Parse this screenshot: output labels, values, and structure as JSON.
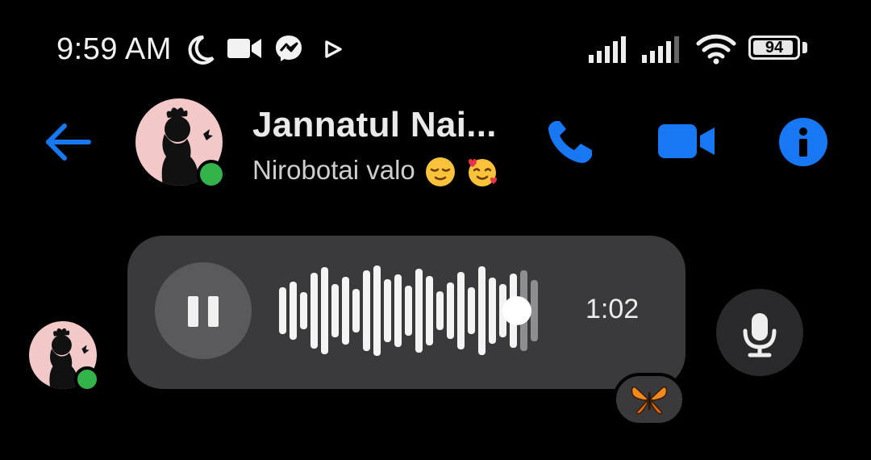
{
  "status_bar": {
    "time": "9:59 AM",
    "battery_level": 94,
    "battery_label": "94",
    "icons": [
      "moon-icon",
      "video-camera-icon",
      "messenger-icon",
      "play-icon",
      "signal-icon",
      "signal-icon",
      "wifi-icon",
      "battery-icon"
    ]
  },
  "header": {
    "back_icon": "back-arrow-icon",
    "contact_name": "Jannatul Nai...",
    "contact_status": "Nirobotai valo",
    "status_emojis": [
      "relieved-face",
      "smiling-face-with-hearts"
    ],
    "online": true,
    "actions": [
      "phone-icon",
      "video-icon",
      "info-icon"
    ]
  },
  "message": {
    "type": "voice",
    "duration": "1:02",
    "playback_progress": 0.92,
    "state": "playing",
    "reaction": "butterfly"
  },
  "composer": {
    "mic_icon": "microphone-icon"
  },
  "colors": {
    "accent": "#1877f2",
    "bubble": "#3a3a3c",
    "online": "#33b34a",
    "background": "#000000"
  }
}
